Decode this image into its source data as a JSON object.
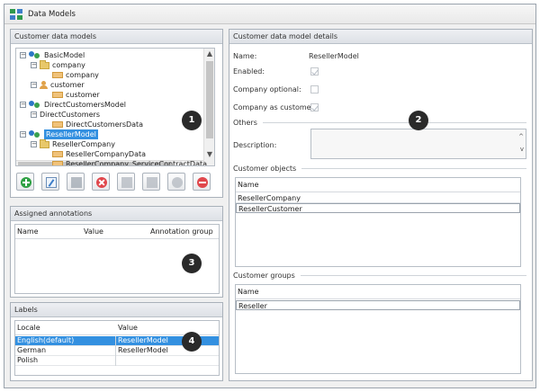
{
  "window": {
    "title": "Data Models"
  },
  "left": {
    "models_panel_title": "Customer data models",
    "tree": [
      {
        "label": "BasicModel",
        "icon": "users-icon",
        "level": 0,
        "expander": "−"
      },
      {
        "label": "company",
        "icon": "folder-icon",
        "level": 1,
        "expander": "−"
      },
      {
        "label": "company",
        "icon": "entity-icon",
        "level": 2,
        "expander": ""
      },
      {
        "label": "customer",
        "icon": "person-icon",
        "level": 1,
        "expander": "−"
      },
      {
        "label": "customer",
        "icon": "entity-icon",
        "level": 2,
        "expander": ""
      },
      {
        "label": "DirectCustomersModel",
        "icon": "users-icon",
        "level": 0,
        "expander": "−"
      },
      {
        "label": "DirectCustomers",
        "icon": "none",
        "level": 1,
        "expander": "−"
      },
      {
        "label": "DirectCustomersData",
        "icon": "entity-icon",
        "level": 2,
        "expander": ""
      },
      {
        "label": "ResellerModel",
        "icon": "users-icon",
        "level": 0,
        "expander": "−",
        "selected": true
      },
      {
        "label": "ResellerCompany",
        "icon": "folder-icon",
        "level": 1,
        "expander": "−"
      },
      {
        "label": "ResellerCompanyData",
        "icon": "entity-icon",
        "level": 2,
        "expander": ""
      },
      {
        "label": "ResellerCompany_ServiceContractData",
        "icon": "entity-icon",
        "level": 2,
        "expander": ""
      }
    ],
    "toolbar": [
      {
        "name": "add-model-button",
        "glyph": "g-add"
      },
      {
        "name": "edit-model-button",
        "glyph": "g-edit"
      },
      {
        "name": "list-button",
        "glyph": "g-list"
      },
      {
        "name": "delete-model-button",
        "glyph": "g-del"
      },
      {
        "name": "move-up-button",
        "glyph": "g-up"
      },
      {
        "name": "move-down-button",
        "glyph": "g-down"
      },
      {
        "name": "cancel-button",
        "glyph": "g-cancel"
      },
      {
        "name": "remove-button",
        "glyph": "g-remove"
      }
    ],
    "annotations": {
      "title": "Assigned annotations",
      "columns": [
        "Name",
        "Value",
        "Annotation group"
      ]
    },
    "labels": {
      "title": "Labels",
      "columns": [
        "Locale",
        "Value"
      ],
      "rows": [
        [
          "English(default)",
          "ResellerModel"
        ],
        [
          "German",
          "ResellerModel"
        ],
        [
          "Polish",
          ""
        ]
      ]
    }
  },
  "right": {
    "panel_title": "Customer data model details",
    "name_label": "Name:",
    "name_value": "ResellerModel",
    "enabled_label": "Enabled:",
    "enabled": true,
    "company_optional_label": "Company optional:",
    "company_optional": false,
    "company_as_customer_label": "Company as customer:",
    "company_as_customer": true,
    "others_title": "Others",
    "description_label": "Description:",
    "description_value": "",
    "objects_title": "Customer objects",
    "objects_header": "Name",
    "objects": [
      "ResellerCompany",
      "ResellerCustomer"
    ],
    "groups_title": "Customer groups",
    "groups_header": "Name",
    "groups": [
      "Reseller"
    ]
  },
  "badges": [
    "1",
    "2",
    "3",
    "4"
  ]
}
